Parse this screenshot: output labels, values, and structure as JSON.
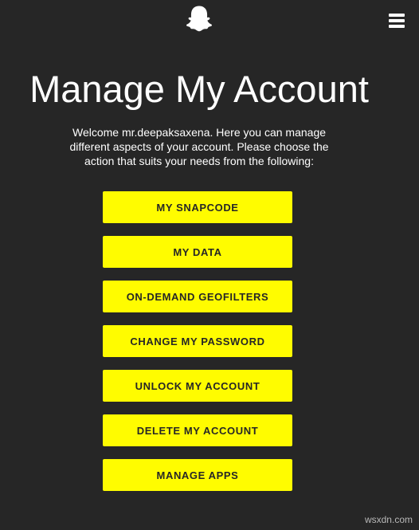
{
  "header": {
    "logo_icon": "snapchat-ghost-icon",
    "menu_icon": "hamburger-menu-icon"
  },
  "page": {
    "title": "Manage My Account",
    "welcome": "Welcome mr.deepaksaxena. Here you can manage different aspects of your account. Please choose the action that suits your needs from the following:"
  },
  "actions": [
    {
      "label": "MY SNAPCODE"
    },
    {
      "label": "MY DATA"
    },
    {
      "label": "ON-DEMAND GEOFILTERS"
    },
    {
      "label": "CHANGE MY PASSWORD"
    },
    {
      "label": "UNLOCK MY ACCOUNT"
    },
    {
      "label": "DELETE MY ACCOUNT"
    },
    {
      "label": "MANAGE APPS"
    }
  ],
  "watermark": "wsxdn.com",
  "colors": {
    "background": "#262626",
    "button": "#fffc00",
    "button_text": "#262626",
    "text": "#ffffff"
  }
}
